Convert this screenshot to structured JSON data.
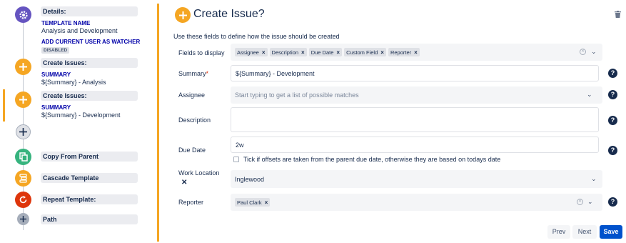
{
  "workflow": {
    "details": {
      "header": "Details:",
      "template_name_label": "TEMPLATE NAME",
      "template_name_value": "Analysis and Development",
      "watcher_label": "ADD CURRENT USER AS WATCHER",
      "watcher_status": "DISABLED"
    },
    "create_issue_1": {
      "header": "Create Issues:",
      "summary_label": "SUMMARY",
      "summary_value": "${Summary} - Analysis"
    },
    "create_issue_2": {
      "header": "Create Issues:",
      "summary_label": "SUMMARY",
      "summary_value": "${Summary} - Development"
    },
    "copy_from_parent": "Copy From Parent",
    "cascade_template": "Cascade Template",
    "repeat_template": "Repeat Template:",
    "path": "Path",
    "icons": [
      "gear-icon",
      "plus-icon",
      "plus-icon",
      "add-step-icon",
      "copy-icon",
      "cascade-icon",
      "repeat-icon",
      "path-icon"
    ],
    "colors": {
      "details": "#6554c0",
      "create": "#f5a623",
      "copy": "#36b37e",
      "cascade": "#f5a623",
      "repeat": "#de350b",
      "path": "#a5adba"
    }
  },
  "form": {
    "title": "Create Issue?",
    "subtitle": "Use these fields to define how the issue should be created",
    "fields_to_display": {
      "label": "Fields to display",
      "tags": [
        "Assignee",
        "Description",
        "Due Date",
        "Custom Field",
        "Reporter"
      ]
    },
    "summary": {
      "label": "Summary",
      "required_mark": "*",
      "value": "${Summary} - Development"
    },
    "assignee": {
      "label": "Assignee",
      "placeholder": "Start typing to get a list of possible matches"
    },
    "description": {
      "label": "Description",
      "value": ""
    },
    "due_date": {
      "label": "Due Date",
      "value": "2w",
      "checkbox_label": "Tick if offsets are taken from the parent due date, otherwise they are based on todays date",
      "checked": false
    },
    "work_location": {
      "label": "Work Location",
      "value": "Inglewood"
    },
    "reporter": {
      "label": "Reporter",
      "tags": [
        "Paul Clark"
      ]
    },
    "help_icon": "question-icon",
    "accent_color": "#f5a623"
  },
  "buttons": {
    "prev": "Prev",
    "next": "Next",
    "save": "Save",
    "primary_color": "#0052cc"
  }
}
